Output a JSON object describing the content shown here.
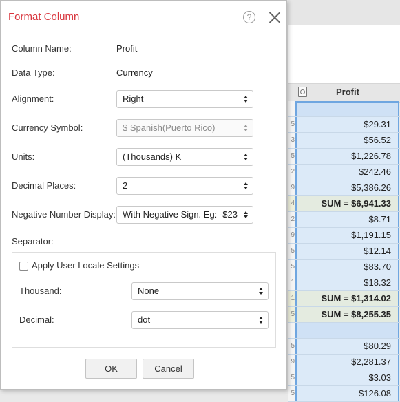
{
  "dialog": {
    "title": "Format Column",
    "help_icon_glyph": "?"
  },
  "form": {
    "column_name_label": "Column Name:",
    "column_name_value": "Profit",
    "data_type_label": "Data Type:",
    "data_type_value": "Currency",
    "alignment_label": "Alignment:",
    "alignment_value": "Right",
    "currency_symbol_label": "Currency Symbol:",
    "currency_symbol_value": "$ Spanish(Puerto Rico)",
    "units_label": "Units:",
    "units_value": "(Thousands) K",
    "decimal_places_label": "Decimal Places:",
    "decimal_places_value": "2",
    "negative_display_label": "Negative Number Display:",
    "negative_display_value": "With Negative Sign. Eg: -$23"
  },
  "separator": {
    "heading": "Separator:",
    "apply_locale_label": "Apply User Locale Settings",
    "apply_locale_checked": false,
    "thousand_label": "Thousand:",
    "thousand_value": "None",
    "decimal_label": "Decimal:",
    "decimal_value": "dot"
  },
  "buttons": {
    "ok": "OK",
    "cancel": "Cancel"
  },
  "sheet": {
    "column_header": "Profit",
    "rows": [
      {
        "stub": "",
        "value": "",
        "kind": "blank"
      },
      {
        "stub": "5",
        "value": "$29.31",
        "kind": "data"
      },
      {
        "stub": "3",
        "value": "$56.52",
        "kind": "data"
      },
      {
        "stub": "5",
        "value": "$1,226.78",
        "kind": "data"
      },
      {
        "stub": "2",
        "value": "$242.46",
        "kind": "data"
      },
      {
        "stub": "9",
        "value": "$5,386.26",
        "kind": "data"
      },
      {
        "stub": "4",
        "value": "SUM = $6,941.33",
        "kind": "sum"
      },
      {
        "stub": "2",
        "value": "$8.71",
        "kind": "data"
      },
      {
        "stub": "9",
        "value": "$1,191.15",
        "kind": "data"
      },
      {
        "stub": "5",
        "value": "$12.14",
        "kind": "data"
      },
      {
        "stub": "5",
        "value": "$83.70",
        "kind": "data"
      },
      {
        "stub": "1",
        "value": "$18.32",
        "kind": "data"
      },
      {
        "stub": "1",
        "value": "SUM = $1,314.02",
        "kind": "sum"
      },
      {
        "stub": "5",
        "value": "SUM = $8,255.35",
        "kind": "sum"
      },
      {
        "stub": "",
        "value": "",
        "kind": "blank"
      },
      {
        "stub": "5",
        "value": "$80.29",
        "kind": "data"
      },
      {
        "stub": "9",
        "value": "$2,281.37",
        "kind": "data"
      },
      {
        "stub": "5",
        "value": "$3.03",
        "kind": "data"
      },
      {
        "stub": "5",
        "value": "$126.08",
        "kind": "data"
      }
    ]
  },
  "colors": {
    "title": "#d9363e",
    "selection_border": "#6fa6e0",
    "selection_fill": "#dceaf8"
  }
}
